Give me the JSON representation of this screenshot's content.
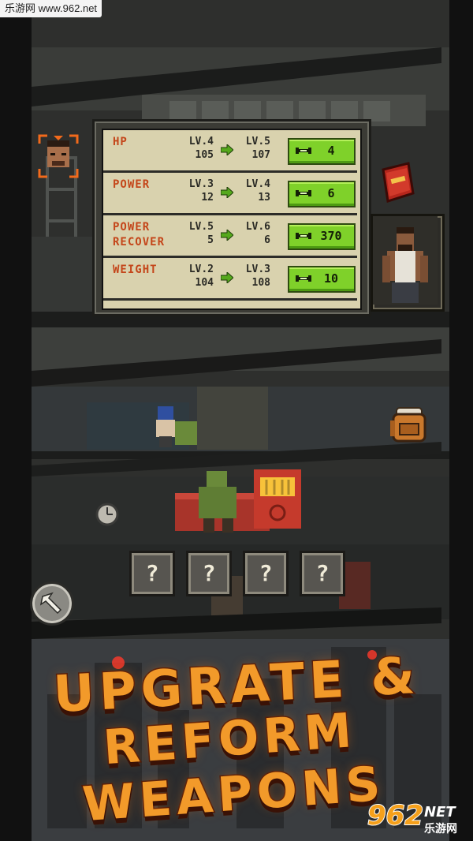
{
  "watermark": "乐游网 www.962.net",
  "stats": [
    {
      "name": "HP",
      "lv_from": "LV.4",
      "lv_to": "LV.5",
      "val_from": "105",
      "val_to": "107",
      "cost": "4"
    },
    {
      "name": "POWER",
      "lv_from": "LV.3",
      "lv_to": "LV.4",
      "val_from": "12",
      "val_to": "13",
      "cost": "6"
    },
    {
      "name": "POWER\nRECOVER",
      "lv_from": "LV.5",
      "lv_to": "LV.6",
      "val_from": "5",
      "val_to": "6",
      "cost": "370"
    },
    {
      "name": "WEIGHT",
      "lv_from": "LV.2",
      "lv_to": "LV.3",
      "val_from": "104",
      "val_to": "108",
      "cost": "10"
    }
  ],
  "slots": [
    "?",
    "?",
    "?",
    "?"
  ],
  "promo": {
    "line1": "UPGRATE &",
    "line2": "REFORM WEAPONS"
  },
  "logo": {
    "big": "962",
    "net": "NET",
    "cn": "乐游网"
  },
  "colors": {
    "accent_green": "#7fd12a",
    "stat_name": "#c4461a",
    "title_orange": "#f29a2a"
  }
}
